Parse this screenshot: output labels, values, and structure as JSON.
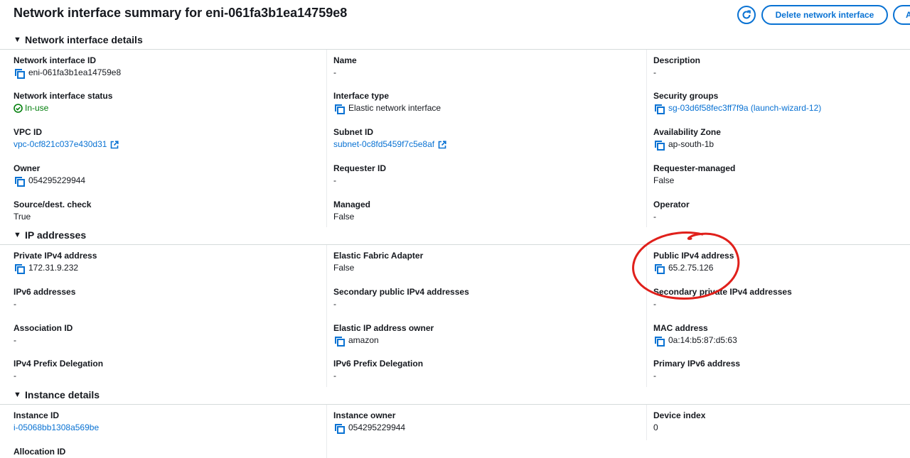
{
  "header": {
    "title": "Network interface summary for eni-061fa3b1ea14759e8",
    "delete_button": "Delete network interface",
    "actions_button": "A"
  },
  "sections": {
    "details": {
      "title": "Network interface details",
      "fields": {
        "eni_id": {
          "label": "Network interface ID",
          "value": "eni-061fa3b1ea14759e8"
        },
        "name": {
          "label": "Name",
          "value": "-"
        },
        "description": {
          "label": "Description",
          "value": "-"
        },
        "status": {
          "label": "Network interface status",
          "value": "In-use"
        },
        "interface_type": {
          "label": "Interface type",
          "value": "Elastic network interface"
        },
        "security_groups": {
          "label": "Security groups",
          "value": "sg-03d6f58fec3ff7f9a (launch-wizard-12)"
        },
        "vpc_id": {
          "label": "VPC ID",
          "value": "vpc-0cf821c037e430d31"
        },
        "subnet_id": {
          "label": "Subnet ID",
          "value": "subnet-0c8fd5459f7c5e8af"
        },
        "availability_zone": {
          "label": "Availability Zone",
          "value": "ap-south-1b"
        },
        "owner": {
          "label": "Owner",
          "value": "054295229944"
        },
        "requester_id": {
          "label": "Requester ID",
          "value": "-"
        },
        "requester_managed": {
          "label": "Requester-managed",
          "value": "False"
        },
        "source_dest": {
          "label": "Source/dest. check",
          "value": "True"
        },
        "managed": {
          "label": "Managed",
          "value": "False"
        },
        "operator": {
          "label": "Operator",
          "value": "-"
        }
      }
    },
    "ip": {
      "title": "IP addresses",
      "fields": {
        "private_ipv4": {
          "label": "Private IPv4 address",
          "value": "172.31.9.232"
        },
        "efa": {
          "label": "Elastic Fabric Adapter",
          "value": "False"
        },
        "public_ipv4": {
          "label": "Public IPv4 address",
          "value": "65.2.75.126"
        },
        "ipv6": {
          "label": "IPv6 addresses",
          "value": "-"
        },
        "secondary_public": {
          "label": "Secondary public IPv4 addresses",
          "value": "-"
        },
        "secondary_private": {
          "label": "Secondary private IPv4 addresses",
          "value": "-"
        },
        "association_id": {
          "label": "Association ID",
          "value": "-"
        },
        "eip_owner": {
          "label": "Elastic IP address owner",
          "value": "amazon"
        },
        "mac": {
          "label": "MAC address",
          "value": "0a:14:b5:87:d5:63"
        },
        "ipv4_prefix": {
          "label": "IPv4 Prefix Delegation",
          "value": "-"
        },
        "ipv6_prefix": {
          "label": "IPv6 Prefix Delegation",
          "value": "-"
        },
        "primary_ipv6": {
          "label": "Primary IPv6 address",
          "value": "-"
        }
      }
    },
    "instance": {
      "title": "Instance details",
      "fields": {
        "instance_id": {
          "label": "Instance ID",
          "value": "i-05068bb1308a569be"
        },
        "instance_owner": {
          "label": "Instance owner",
          "value": "054295229944"
        },
        "device_index": {
          "label": "Device index",
          "value": "0"
        },
        "allocation_id": {
          "label": "Allocation ID",
          "value": ""
        }
      }
    }
  },
  "icons": {
    "refresh": "refresh-icon",
    "copy": "copy-icon",
    "external": "external-link-icon",
    "status": "check-circle-icon",
    "caret": "caret-down-icon"
  },
  "colors": {
    "link": "#0972d3",
    "success": "#037f0c",
    "annotation": "#e0201b"
  }
}
